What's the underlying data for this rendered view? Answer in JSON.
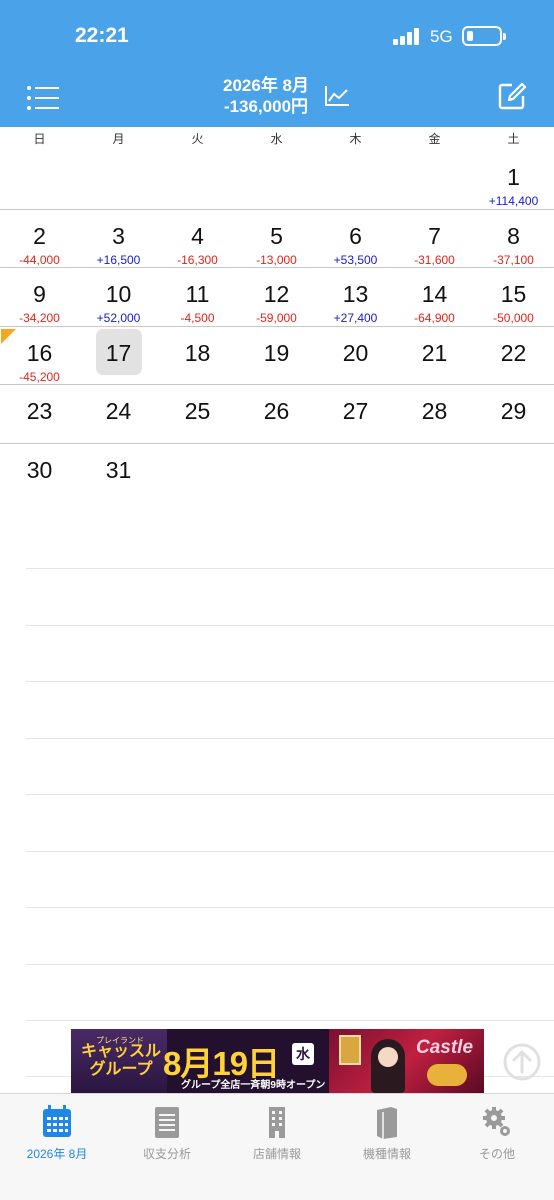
{
  "status_bar": {
    "time": "22:21",
    "network": "5G"
  },
  "header": {
    "month_title": "2026年 8月",
    "month_total": "-136,000円"
  },
  "weekdays": [
    "日",
    "月",
    "火",
    "水",
    "木",
    "金",
    "土"
  ],
  "calendar": {
    "today": "17",
    "flagged_day": "16",
    "weeks": [
      [
        null,
        null,
        null,
        null,
        null,
        null,
        {
          "day": "1",
          "amount": "+114,400"
        }
      ],
      [
        {
          "day": "2",
          "amount": "-44,000"
        },
        {
          "day": "3",
          "amount": "+16,500"
        },
        {
          "day": "4",
          "amount": "-16,300"
        },
        {
          "day": "5",
          "amount": "-13,000"
        },
        {
          "day": "6",
          "amount": "+53,500"
        },
        {
          "day": "7",
          "amount": "-31,600"
        },
        {
          "day": "8",
          "amount": "-37,100"
        }
      ],
      [
        {
          "day": "9",
          "amount": "-34,200"
        },
        {
          "day": "10",
          "amount": "+52,000"
        },
        {
          "day": "11",
          "amount": "-4,500"
        },
        {
          "day": "12",
          "amount": "-59,000"
        },
        {
          "day": "13",
          "amount": "+27,400"
        },
        {
          "day": "14",
          "amount": "-64,900"
        },
        {
          "day": "15",
          "amount": "-50,000"
        }
      ],
      [
        {
          "day": "16",
          "amount": "-45,200"
        },
        {
          "day": "17",
          "amount": ""
        },
        {
          "day": "18",
          "amount": ""
        },
        {
          "day": "19",
          "amount": ""
        },
        {
          "day": "20",
          "amount": ""
        },
        {
          "day": "21",
          "amount": ""
        },
        {
          "day": "22",
          "amount": ""
        }
      ],
      [
        {
          "day": "23",
          "amount": ""
        },
        {
          "day": "24",
          "amount": ""
        },
        {
          "day": "25",
          "amount": ""
        },
        {
          "day": "26",
          "amount": ""
        },
        {
          "day": "27",
          "amount": ""
        },
        {
          "day": "28",
          "amount": ""
        },
        {
          "day": "29",
          "amount": ""
        }
      ],
      [
        {
          "day": "30",
          "amount": ""
        },
        {
          "day": "31",
          "amount": ""
        },
        null,
        null,
        null,
        null,
        null
      ]
    ]
  },
  "colors": {
    "header": "#4aa3e8",
    "positive": "#1a1acc",
    "negative": "#e3241b",
    "tab_active": "#1e88e5",
    "flag": "#f5a623"
  },
  "banner": {
    "brand_small": "プレイランド",
    "brand": "キャッスル グループ",
    "date": "8月19日",
    "weekday": "水",
    "subtitle": "グループ全店一斉朝9時オープン",
    "logo": "Castle"
  },
  "tabs": [
    {
      "label": "2026年 8月",
      "icon": "calendar-icon",
      "active": true
    },
    {
      "label": "収支分析",
      "icon": "notepad-icon",
      "active": false
    },
    {
      "label": "店舗情報",
      "icon": "building-icon",
      "active": false
    },
    {
      "label": "機種情報",
      "icon": "book-icon",
      "active": false
    },
    {
      "label": "その他",
      "icon": "gear-icon",
      "active": false
    }
  ]
}
